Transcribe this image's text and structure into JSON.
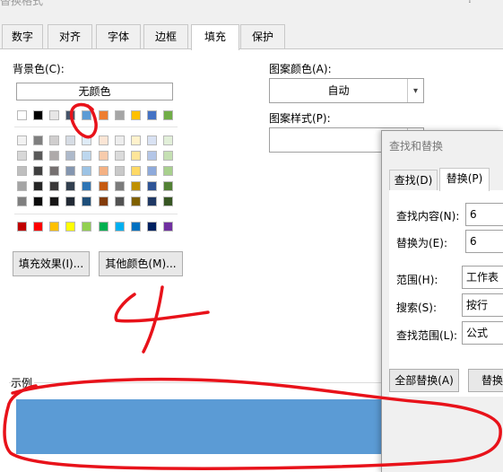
{
  "window": {
    "title": "替换格式",
    "help": "?"
  },
  "tabs": [
    {
      "label": "数字"
    },
    {
      "label": "对齐"
    },
    {
      "label": "字体"
    },
    {
      "label": "边框"
    },
    {
      "label": "填充"
    },
    {
      "label": "保护"
    }
  ],
  "fill": {
    "background_label": "背景色(C):",
    "no_color": "无颜色",
    "pattern_color_label": "图案颜色(A):",
    "pattern_color_value": "自动",
    "pattern_style_label": "图案样式(P):",
    "fill_effects_button": "填充效果(I)...",
    "more_colors_button": "其他颜色(M)...",
    "sample_label": "示例",
    "sample_color": "#5B9BD5",
    "palette": {
      "theme_row": [
        "#FFFFFF",
        "#000000",
        "#E7E6E6",
        "#44546A",
        "#5B9BD5",
        "#ED7D31",
        "#A5A5A5",
        "#FFC000",
        "#4472C4",
        "#70AD47"
      ],
      "tint_rows": [
        [
          "#F2F2F2",
          "#7F7F7F",
          "#D0CECE",
          "#D6DCE4",
          "#DEEBF6",
          "#FBE5D5",
          "#EDEDED",
          "#FFF2CC",
          "#D9E2F3",
          "#E2EFD9"
        ],
        [
          "#D8D8D8",
          "#595959",
          "#AEAAAA",
          "#ADB9CA",
          "#BDD7EE",
          "#F7CBAC",
          "#DBDBDB",
          "#FEE599",
          "#B4C6E7",
          "#C5E0B3"
        ],
        [
          "#BFBFBF",
          "#3F3F3F",
          "#757070",
          "#8496B0",
          "#9CC3E5",
          "#F4B183",
          "#C9C9C9",
          "#FFD965",
          "#8EAADB",
          "#A8D08D"
        ],
        [
          "#A5A5A5",
          "#262626",
          "#3A3838",
          "#323F4F",
          "#2E75B5",
          "#C55A11",
          "#7B7B7B",
          "#BF9000",
          "#2F5496",
          "#538135"
        ],
        [
          "#7F7F7F",
          "#0C0C0C",
          "#171616",
          "#222A35",
          "#1E4E79",
          "#833C0B",
          "#525252",
          "#7F6000",
          "#1F3864",
          "#375623"
        ]
      ],
      "standard_row": [
        "#C00000",
        "#FF0000",
        "#FFC000",
        "#FFFF00",
        "#92D050",
        "#00B050",
        "#00B0F0",
        "#0070C0",
        "#002060",
        "#7030A0"
      ]
    }
  },
  "find_replace": {
    "title": "查找和替换",
    "tabs": [
      {
        "label": "查找(D)"
      },
      {
        "label": "替换(P)"
      }
    ],
    "find_label": "查找内容(N):",
    "find_value": "6",
    "replace_label": "替换为(E):",
    "replace_value": "6",
    "scope_label": "范围(H):",
    "scope_value": "工作表",
    "search_label": "搜索(S):",
    "search_value": "按行",
    "lookin_label": "查找范围(L):",
    "lookin_value": "公式",
    "replace_all_button": "全部替换(A)",
    "replace_button": "替换"
  },
  "annotation": {
    "handwritten_text": "4",
    "ink_color": "#E8121A"
  }
}
